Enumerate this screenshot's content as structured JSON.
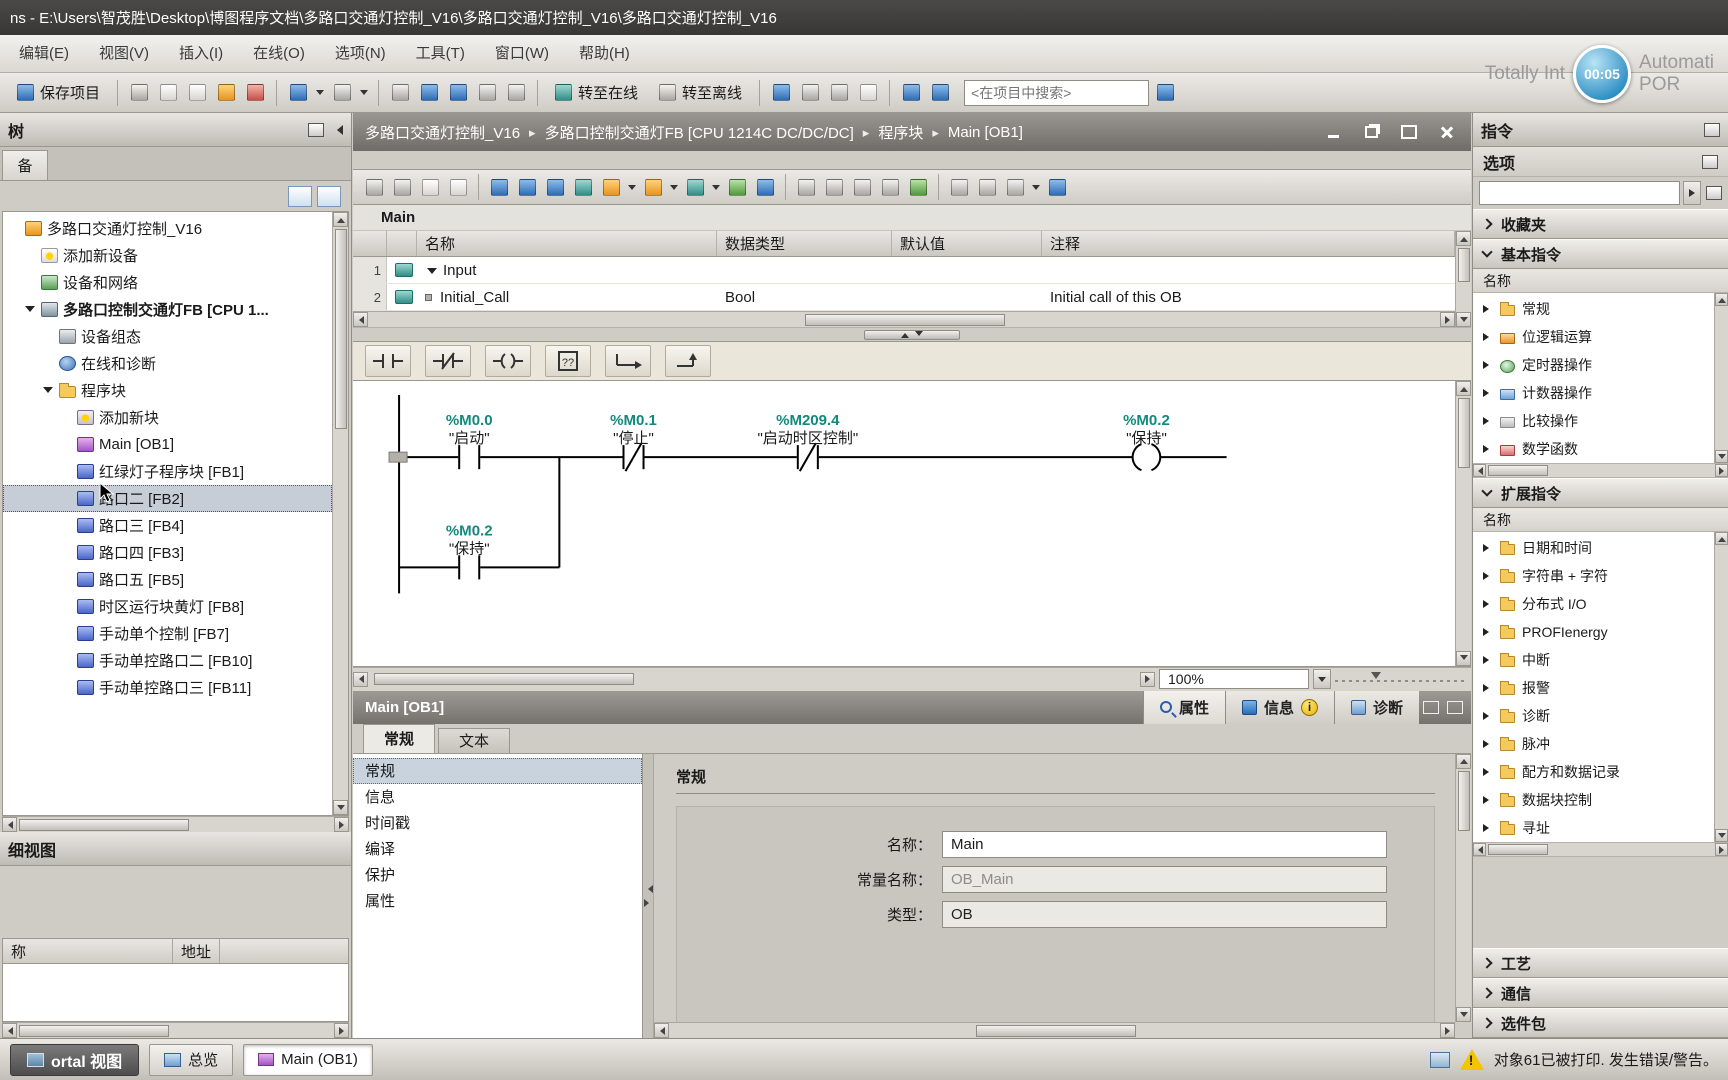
{
  "title_bar": {
    "text": "ns  -  E:\\Users\\智茂胜\\Desktop\\博图程序文档\\多路口交通灯控制_V16\\多路口交通灯控制_V16\\多路口交通灯控制_V16"
  },
  "menu": {
    "items": [
      "编辑(E)",
      "视图(V)",
      "插入(I)",
      "在线(O)",
      "选项(N)",
      "工具(T)",
      "窗口(W)",
      "帮助(H)"
    ],
    "logo": {
      "part1": "Totally Int",
      "time": "00:05",
      "part2": "Automati",
      "part3": "POR"
    }
  },
  "toolbar": {
    "save": "保存项目",
    "go_online": "转至在线",
    "go_offline": "转至离线",
    "search_placeholder": "<在项目中搜索>"
  },
  "project_tree": {
    "header": "树",
    "tab": "备",
    "items": [
      {
        "label": "多路口交通灯控制_V16",
        "icon": "project",
        "depth": 0
      },
      {
        "label": "添加新设备",
        "icon": "add-device",
        "depth": 1
      },
      {
        "label": "设备和网络",
        "icon": "network",
        "depth": 1
      },
      {
        "label": "多路口控制交通灯FB [CPU 1...",
        "icon": "plc",
        "depth": 1,
        "bold": true,
        "expanded": true
      },
      {
        "label": "设备组态",
        "icon": "device-config",
        "depth": 2
      },
      {
        "label": "在线和诊断",
        "icon": "diagnostics",
        "depth": 2
      },
      {
        "label": "程序块",
        "icon": "folder",
        "depth": 2,
        "expanded": true
      },
      {
        "label": "添加新块",
        "icon": "add-block",
        "depth": 3
      },
      {
        "label": "Main [OB1]",
        "icon": "ob",
        "depth": 3
      },
      {
        "label": "红绿灯子程序块 [FB1]",
        "icon": "fb",
        "depth": 3
      },
      {
        "label": "路口二 [FB2]",
        "icon": "fb",
        "depth": 3,
        "selected": true
      },
      {
        "label": "路口三 [FB4]",
        "icon": "fb",
        "depth": 3
      },
      {
        "label": "路口四 [FB3]",
        "icon": "fb",
        "depth": 3
      },
      {
        "label": "路口五 [FB5]",
        "icon": "fb",
        "depth": 3
      },
      {
        "label": "时区运行块黄灯 [FB8]",
        "icon": "fb",
        "depth": 3
      },
      {
        "label": "手动单个控制 [FB7]",
        "icon": "fb",
        "depth": 3
      },
      {
        "label": "手动单控路口二 [FB10]",
        "icon": "fb",
        "depth": 3
      },
      {
        "label": "手动单控路口三 [FB11]",
        "icon": "fb",
        "depth": 3
      }
    ]
  },
  "detail_view": {
    "title": "细视图",
    "columns": [
      "称",
      "地址"
    ]
  },
  "breadcrumb": {
    "parts": [
      "多路口交通灯控制_V16",
      "多路口控制交通灯FB [CPU 1214C DC/DC/DC]",
      "程序块",
      "Main [OB1]"
    ]
  },
  "editor": {
    "title": "Main",
    "table": {
      "columns": [
        "名称",
        "数据类型",
        "默认值",
        "注释"
      ],
      "rows": [
        {
          "num": "1",
          "name": "Input",
          "type": "",
          "default_value": "",
          "comment": ""
        },
        {
          "num": "2",
          "name": "Initial_Call",
          "type": "Bool",
          "default_value": "",
          "comment": "Initial call of this OB"
        }
      ]
    },
    "zoom": "100%"
  },
  "icons": {
    "empty_box_label": "??"
  },
  "ladder": {
    "contacts": [
      {
        "kind": "no-contact",
        "address": "%M0.0",
        "name": "\"启动\""
      },
      {
        "kind": "nc-contact",
        "address": "%M0.1",
        "name": "\"停止\""
      },
      {
        "kind": "nc-contact",
        "address": "%M209.4",
        "name": "\"启动时区控制\""
      },
      {
        "kind": "coil",
        "address": "%M0.2",
        "name": "\"保持\""
      },
      {
        "kind": "no-contact-branch",
        "address": "%M0.2",
        "name": "\"保持\""
      }
    ]
  },
  "properties": {
    "title": "Main [OB1]",
    "tabs": {
      "properties": "属性",
      "info": "信息",
      "diagnostics": "诊断"
    },
    "subtabs": [
      "常规",
      "文本"
    ],
    "nav": [
      {
        "label": "常规",
        "selected": true
      },
      {
        "label": "信息"
      },
      {
        "label": "时间戳"
      },
      {
        "label": "编译"
      },
      {
        "label": "保护"
      },
      {
        "label": "属性"
      }
    ],
    "section": "常规",
    "fields": [
      {
        "label": "名称：",
        "value": "Main"
      },
      {
        "label": "常量名称：",
        "value": "OB_Main",
        "disabled": true
      },
      {
        "label": "类型：",
        "value": "OB",
        "readonly": true
      }
    ]
  },
  "instructions": {
    "title": "指令",
    "options": "选项",
    "sections": [
      {
        "label": "收藏夹",
        "expanded": false
      },
      {
        "label": "基本指令",
        "expanded": true,
        "col": "名称",
        "items": [
          {
            "label": "常规",
            "icon": "folder"
          },
          {
            "label": "位逻辑运算",
            "icon": "bitlogic"
          },
          {
            "label": "定时器操作",
            "icon": "timer"
          },
          {
            "label": "计数器操作",
            "icon": "counter"
          },
          {
            "label": "比较操作",
            "icon": "compare"
          },
          {
            "label": "数学函数",
            "icon": "math"
          }
        ]
      },
      {
        "label": "扩展指令",
        "expanded": true,
        "col": "名称",
        "items": [
          {
            "label": "日期和时间",
            "icon": "folder"
          },
          {
            "label": "字符串 + 字符",
            "icon": "folder"
          },
          {
            "label": "分布式 I/O",
            "icon": "folder"
          },
          {
            "label": "PROFIenergy",
            "icon": "folder"
          },
          {
            "label": "中断",
            "icon": "folder"
          },
          {
            "label": "报警",
            "icon": "folder"
          },
          {
            "label": "诊断",
            "icon": "folder"
          },
          {
            "label": "脉冲",
            "icon": "folder"
          },
          {
            "label": "配方和数据记录",
            "icon": "folder"
          },
          {
            "label": "数据块控制",
            "icon": "folder"
          },
          {
            "label": "寻址",
            "icon": "folder"
          }
        ]
      },
      {
        "label": "工艺",
        "expanded": false
      },
      {
        "label": "通信",
        "expanded": false
      },
      {
        "label": "选件包",
        "expanded": false
      }
    ]
  },
  "status_bar": {
    "portal": "ortal 视图",
    "overview": "总览",
    "task": "Main (OB1)",
    "message": "对象61已被打印. 发生错误/警告。"
  }
}
